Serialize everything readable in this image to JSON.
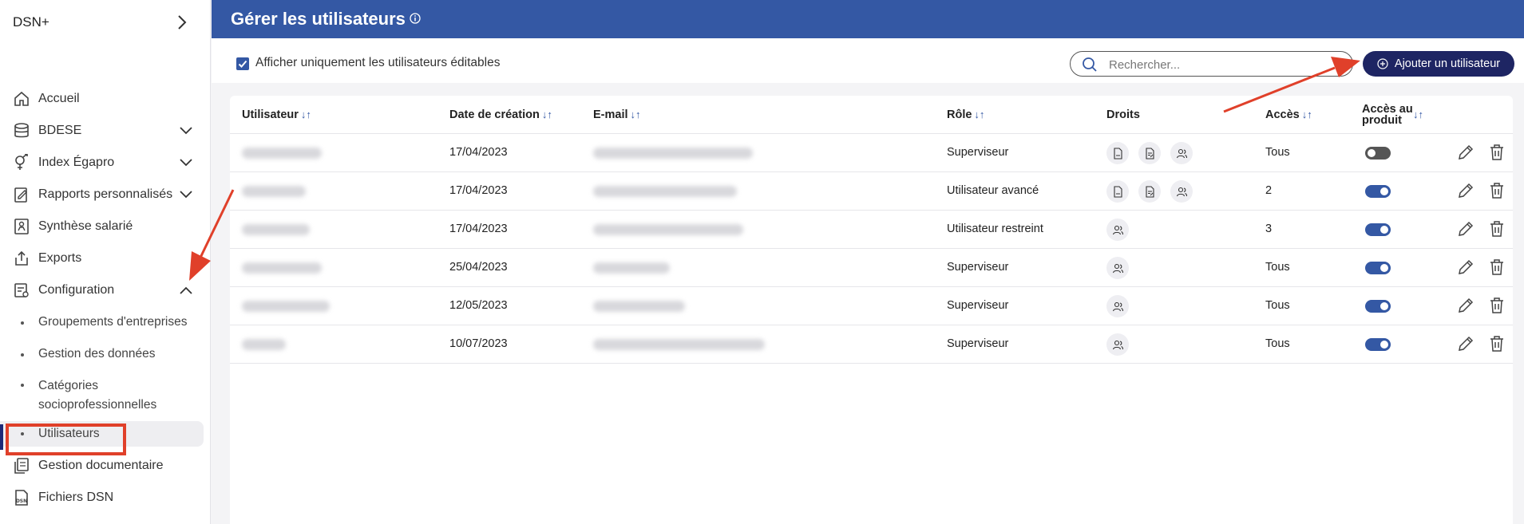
{
  "app": {
    "brand": "DSN+"
  },
  "sidebar": {
    "items": [
      {
        "label": "Accueil",
        "icon": "home-icon"
      },
      {
        "label": "BDESE",
        "icon": "database-icon",
        "chevron": "down"
      },
      {
        "label": "Index Égapro",
        "icon": "gender-icon",
        "chevron": "down"
      },
      {
        "label": "Rapports personnalisés",
        "icon": "report-icon",
        "chevron": "down"
      },
      {
        "label": "Synthèse salarié",
        "icon": "person-doc-icon"
      },
      {
        "label": "Exports",
        "icon": "export-icon"
      },
      {
        "label": "Configuration",
        "icon": "config-icon",
        "chevron": "up"
      }
    ],
    "sub_items": [
      {
        "label": "Groupements d'entreprises"
      },
      {
        "label": "Gestion des données"
      },
      {
        "label": "Catégories socioprofessionnelles"
      },
      {
        "label": "Utilisateurs",
        "active": true
      }
    ],
    "bottom_items": [
      {
        "label": "Gestion documentaire",
        "icon": "documents-icon"
      },
      {
        "label": "Fichiers DSN",
        "icon": "dsn-file-icon",
        "icon_text": "DSN"
      }
    ]
  },
  "header": {
    "title": "Gérer les utilisateurs"
  },
  "toolbar": {
    "checkbox_label": "Afficher uniquement les utilisateurs éditables",
    "checkbox_checked": true,
    "search_placeholder": "Rechercher...",
    "add_button": "Ajouter un utilisateur"
  },
  "table": {
    "headers": {
      "user": "Utilisateur",
      "created": "Date de création",
      "email": "E-mail",
      "role": "Rôle",
      "rights": "Droits",
      "access": "Accès",
      "product_access": "Accès au produit",
      "sort_glyph": "↓↑"
    },
    "rows": [
      {
        "date": "17/04/2023",
        "role": "Superviseur",
        "rights": [
          "pdf-doc-icon",
          "edit-doc-icon",
          "users-icon"
        ],
        "access": "Tous",
        "product_access": false
      },
      {
        "date": "17/04/2023",
        "role": "Utilisateur avancé",
        "rights": [
          "pdf-doc-icon",
          "edit-doc-icon",
          "users-icon"
        ],
        "access": "2",
        "product_access": true
      },
      {
        "date": "17/04/2023",
        "role": "Utilisateur restreint",
        "rights": [
          "users-icon"
        ],
        "access": "3",
        "product_access": true
      },
      {
        "date": "25/04/2023",
        "role": "Superviseur",
        "rights": [
          "users-icon"
        ],
        "access": "Tous",
        "product_access": true
      },
      {
        "date": "12/05/2023",
        "role": "Superviseur",
        "rights": [
          "users-icon"
        ],
        "access": "Tous",
        "product_access": true
      },
      {
        "date": "10/07/2023",
        "role": "Superviseur",
        "rights": [
          "users-icon"
        ],
        "access": "Tous",
        "product_access": true
      }
    ]
  },
  "colors": {
    "header": "#3458a4",
    "primary_button": "#1e2563",
    "annotation": "#e0402a"
  }
}
